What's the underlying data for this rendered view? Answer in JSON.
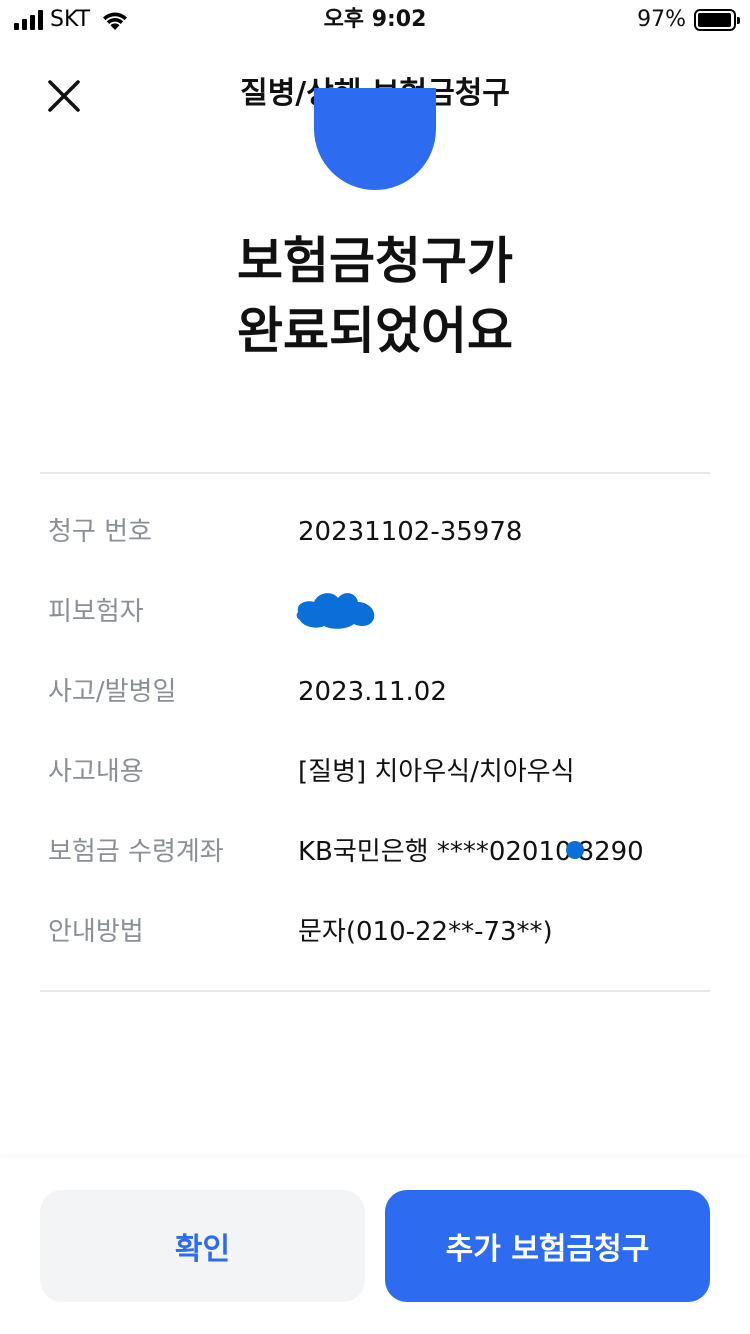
{
  "status_bar": {
    "carrier": "SKT",
    "time": "오후 9:02",
    "battery_percent": "97%"
  },
  "header": {
    "title": "질병/상해 보험금청구",
    "close_icon": "close-icon"
  },
  "hero": {
    "line1": "보험금청구가",
    "line2": "완료되었어요"
  },
  "details": {
    "claim_number": {
      "label": "청구 번호",
      "value": "20231102-35978"
    },
    "insured": {
      "label": "피보험자",
      "value": ""
    },
    "accident_date": {
      "label": "사고/발병일",
      "value": "2023.11.02"
    },
    "accident_content": {
      "label": "사고내용",
      "value": "[질병] 치아우식/치아우식"
    },
    "payout_account": {
      "label": "보험금 수령계좌",
      "value_prefix": "KB국민은행 ****02010",
      "value_suffix": "8290"
    },
    "notification": {
      "label": "안내방법",
      "value": "문자(010-22**-73**)"
    }
  },
  "buttons": {
    "confirm": "확인",
    "additional_claim": "추가 보험금청구"
  },
  "colors": {
    "accent": "#2d6cf0",
    "label_gray": "#8a8f98",
    "divider": "#e6e7ea",
    "secondary_button_bg": "#f3f4f6",
    "redaction_blue": "#0a6fd8"
  }
}
